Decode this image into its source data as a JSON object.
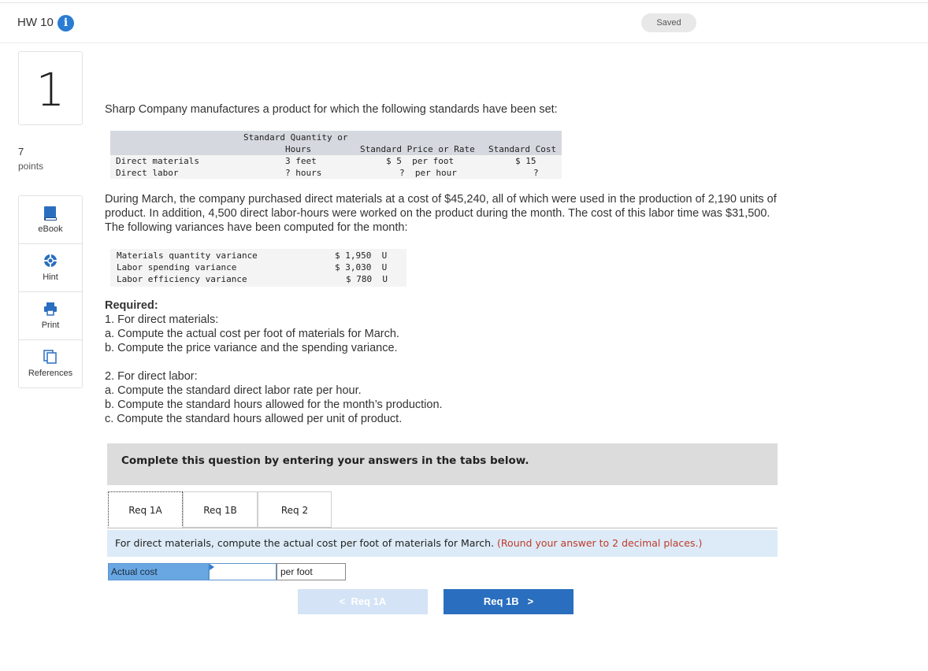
{
  "header": {
    "title": "HW 10",
    "info_icon": "i",
    "saved": "Saved"
  },
  "question": {
    "number": "1",
    "points": "7",
    "points_label": "points"
  },
  "tools": [
    {
      "label": "eBook",
      "icon": "book-icon"
    },
    {
      "label": "Hint",
      "icon": "hint-icon"
    },
    {
      "label": "Print",
      "icon": "print-icon"
    },
    {
      "label": "References",
      "icon": "references-icon"
    }
  ],
  "intro": "Sharp Company manufactures a product for which the following standards have been set:",
  "standards_table": {
    "header": {
      "quantity_line1": "Standard Quantity or",
      "quantity_line2": "Hours",
      "price": "Standard Price or Rate",
      "cost": "Standard Cost"
    },
    "rows": [
      {
        "label": "Direct materials",
        "quantity": "3 feet",
        "price": "$ 5  per foot",
        "cost": "$ 15"
      },
      {
        "label": "Direct labor",
        "quantity": "? hours",
        "price": "?  per hour",
        "cost": "?"
      }
    ]
  },
  "paragraph": [
    "During March, the company purchased direct materials at a cost of $45,240, all of which were used in the production of 2,190 units of",
    "product. In addition, 4,500 direct labor-hours were worked on the product during the month. The cost of this labor time was $31,500.",
    "The following variances have been computed for the month:"
  ],
  "variances": [
    {
      "label": "Materials quantity variance",
      "value": "$ 1,950  U"
    },
    {
      "label": "Labor spending variance",
      "value": "$ 3,030  U"
    },
    {
      "label": "Labor efficiency variance",
      "value": "$ 780  U"
    }
  ],
  "required": {
    "heading": "Required:",
    "lines1": [
      "1. For direct materials:",
      "a. Compute the actual cost per foot of materials for March.",
      "b. Compute the price variance and the spending variance."
    ],
    "lines2": [
      "2. For direct labor:",
      "a. Compute the standard direct labor rate per hour.",
      "b. Compute the standard hours allowed for the month’s production.",
      "c. Compute the standard hours allowed per unit of product."
    ]
  },
  "complete_text": "Complete this question by entering your answers in the tabs below.",
  "tabs": [
    "Req 1A",
    "Req 1B",
    "Req 2"
  ],
  "instruction": {
    "text": "For direct materials, compute the actual cost per foot of materials for March.",
    "note": "(Round your answer to 2 decimal places.)"
  },
  "answer": {
    "label": "Actual cost",
    "value": "",
    "unit": "per foot"
  },
  "nav": {
    "prev": "Req 1A",
    "next": "Req 1B"
  },
  "colors": {
    "accent": "#2a6ebf",
    "note_red": "#c0392b",
    "instr_bg": "#dcebf7"
  }
}
